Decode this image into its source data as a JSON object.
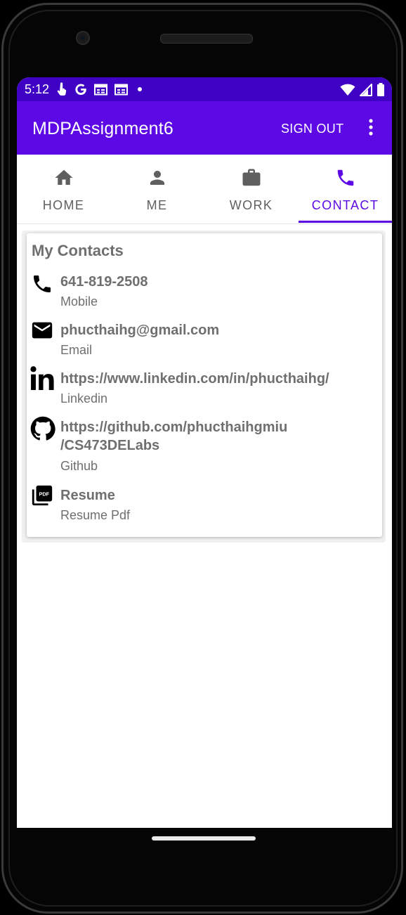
{
  "status_bar": {
    "time": "5:12",
    "left_icons": [
      "touch-icon",
      "google-icon",
      "calendar-icon",
      "calendar-icon",
      "dot-icon"
    ],
    "right_icons": [
      "wifi-icon",
      "signal-icon",
      "battery-icon"
    ]
  },
  "app_bar": {
    "title": "MDPAssignment6",
    "sign_out_label": "SIGN OUT",
    "menu_icon": "more-vert-icon"
  },
  "tabs": [
    {
      "label": "HOME",
      "icon": "home-icon",
      "active": false
    },
    {
      "label": "ME",
      "icon": "person-icon",
      "active": false
    },
    {
      "label": "WORK",
      "icon": "briefcase-icon",
      "active": false
    },
    {
      "label": "CONTACT",
      "icon": "phone-icon",
      "active": true
    }
  ],
  "card": {
    "title": "My Contacts",
    "contacts": [
      {
        "icon": "phone-icon",
        "primary": "641-819-2508",
        "secondary": "Mobile"
      },
      {
        "icon": "email-icon",
        "primary": "phucthaihg@gmail.com",
        "secondary": "Email"
      },
      {
        "icon": "linkedin-icon",
        "primary": "https://www.linkedin.com/in/phucthaihg/",
        "secondary": "Linkedin"
      },
      {
        "icon": "github-icon",
        "primary": "https://github.com/phucthaihgmiu\n/CS473DELabs",
        "secondary": "Github"
      },
      {
        "icon": "pdf-icon",
        "primary": "Resume",
        "secondary": "Resume Pdf"
      }
    ]
  },
  "colors": {
    "status_bar": "#3f02c4",
    "app_bar": "#5d09e6",
    "accent": "#5d09e6",
    "text_gray": "#6f6f6f"
  }
}
